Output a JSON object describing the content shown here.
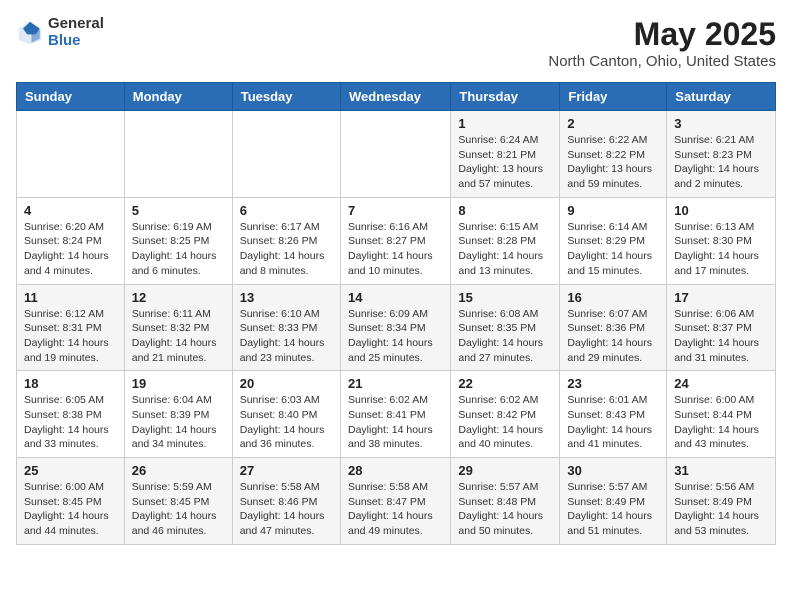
{
  "header": {
    "logo_general": "General",
    "logo_blue": "Blue",
    "title": "May 2025",
    "subtitle": "North Canton, Ohio, United States"
  },
  "days_of_week": [
    "Sunday",
    "Monday",
    "Tuesday",
    "Wednesday",
    "Thursday",
    "Friday",
    "Saturday"
  ],
  "weeks": [
    [
      {
        "num": "",
        "info": ""
      },
      {
        "num": "",
        "info": ""
      },
      {
        "num": "",
        "info": ""
      },
      {
        "num": "",
        "info": ""
      },
      {
        "num": "1",
        "info": "Sunrise: 6:24 AM\nSunset: 8:21 PM\nDaylight: 13 hours and 57 minutes."
      },
      {
        "num": "2",
        "info": "Sunrise: 6:22 AM\nSunset: 8:22 PM\nDaylight: 13 hours and 59 minutes."
      },
      {
        "num": "3",
        "info": "Sunrise: 6:21 AM\nSunset: 8:23 PM\nDaylight: 14 hours and 2 minutes."
      }
    ],
    [
      {
        "num": "4",
        "info": "Sunrise: 6:20 AM\nSunset: 8:24 PM\nDaylight: 14 hours and 4 minutes."
      },
      {
        "num": "5",
        "info": "Sunrise: 6:19 AM\nSunset: 8:25 PM\nDaylight: 14 hours and 6 minutes."
      },
      {
        "num": "6",
        "info": "Sunrise: 6:17 AM\nSunset: 8:26 PM\nDaylight: 14 hours and 8 minutes."
      },
      {
        "num": "7",
        "info": "Sunrise: 6:16 AM\nSunset: 8:27 PM\nDaylight: 14 hours and 10 minutes."
      },
      {
        "num": "8",
        "info": "Sunrise: 6:15 AM\nSunset: 8:28 PM\nDaylight: 14 hours and 13 minutes."
      },
      {
        "num": "9",
        "info": "Sunrise: 6:14 AM\nSunset: 8:29 PM\nDaylight: 14 hours and 15 minutes."
      },
      {
        "num": "10",
        "info": "Sunrise: 6:13 AM\nSunset: 8:30 PM\nDaylight: 14 hours and 17 minutes."
      }
    ],
    [
      {
        "num": "11",
        "info": "Sunrise: 6:12 AM\nSunset: 8:31 PM\nDaylight: 14 hours and 19 minutes."
      },
      {
        "num": "12",
        "info": "Sunrise: 6:11 AM\nSunset: 8:32 PM\nDaylight: 14 hours and 21 minutes."
      },
      {
        "num": "13",
        "info": "Sunrise: 6:10 AM\nSunset: 8:33 PM\nDaylight: 14 hours and 23 minutes."
      },
      {
        "num": "14",
        "info": "Sunrise: 6:09 AM\nSunset: 8:34 PM\nDaylight: 14 hours and 25 minutes."
      },
      {
        "num": "15",
        "info": "Sunrise: 6:08 AM\nSunset: 8:35 PM\nDaylight: 14 hours and 27 minutes."
      },
      {
        "num": "16",
        "info": "Sunrise: 6:07 AM\nSunset: 8:36 PM\nDaylight: 14 hours and 29 minutes."
      },
      {
        "num": "17",
        "info": "Sunrise: 6:06 AM\nSunset: 8:37 PM\nDaylight: 14 hours and 31 minutes."
      }
    ],
    [
      {
        "num": "18",
        "info": "Sunrise: 6:05 AM\nSunset: 8:38 PM\nDaylight: 14 hours and 33 minutes."
      },
      {
        "num": "19",
        "info": "Sunrise: 6:04 AM\nSunset: 8:39 PM\nDaylight: 14 hours and 34 minutes."
      },
      {
        "num": "20",
        "info": "Sunrise: 6:03 AM\nSunset: 8:40 PM\nDaylight: 14 hours and 36 minutes."
      },
      {
        "num": "21",
        "info": "Sunrise: 6:02 AM\nSunset: 8:41 PM\nDaylight: 14 hours and 38 minutes."
      },
      {
        "num": "22",
        "info": "Sunrise: 6:02 AM\nSunset: 8:42 PM\nDaylight: 14 hours and 40 minutes."
      },
      {
        "num": "23",
        "info": "Sunrise: 6:01 AM\nSunset: 8:43 PM\nDaylight: 14 hours and 41 minutes."
      },
      {
        "num": "24",
        "info": "Sunrise: 6:00 AM\nSunset: 8:44 PM\nDaylight: 14 hours and 43 minutes."
      }
    ],
    [
      {
        "num": "25",
        "info": "Sunrise: 6:00 AM\nSunset: 8:45 PM\nDaylight: 14 hours and 44 minutes."
      },
      {
        "num": "26",
        "info": "Sunrise: 5:59 AM\nSunset: 8:45 PM\nDaylight: 14 hours and 46 minutes."
      },
      {
        "num": "27",
        "info": "Sunrise: 5:58 AM\nSunset: 8:46 PM\nDaylight: 14 hours and 47 minutes."
      },
      {
        "num": "28",
        "info": "Sunrise: 5:58 AM\nSunset: 8:47 PM\nDaylight: 14 hours and 49 minutes."
      },
      {
        "num": "29",
        "info": "Sunrise: 5:57 AM\nSunset: 8:48 PM\nDaylight: 14 hours and 50 minutes."
      },
      {
        "num": "30",
        "info": "Sunrise: 5:57 AM\nSunset: 8:49 PM\nDaylight: 14 hours and 51 minutes."
      },
      {
        "num": "31",
        "info": "Sunrise: 5:56 AM\nSunset: 8:49 PM\nDaylight: 14 hours and 53 minutes."
      }
    ]
  ]
}
